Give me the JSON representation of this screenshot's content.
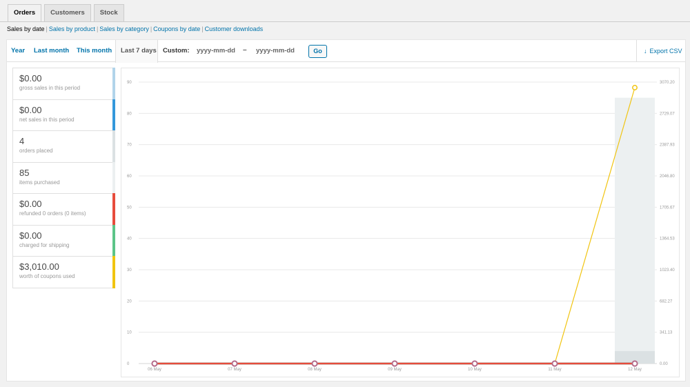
{
  "tabs": [
    {
      "label": "Orders",
      "active": true
    },
    {
      "label": "Customers",
      "active": false
    },
    {
      "label": "Stock",
      "active": false
    }
  ],
  "subnav": {
    "current": "Sales by date",
    "links": [
      "Sales by product",
      "Sales by category",
      "Coupons by date",
      "Customer downloads"
    ]
  },
  "range": {
    "year": "Year",
    "last_month": "Last month",
    "this_month": "This month",
    "last_7_days": "Last 7 days",
    "custom_label": "Custom:",
    "from_placeholder": "yyyy-mm-dd",
    "dash": "–",
    "to_placeholder": "yyyy-mm-dd",
    "go": "Go",
    "export": "Export CSV",
    "export_icon": "download-arrow-icon"
  },
  "legend": [
    {
      "value": "$0.00",
      "label": "gross sales in this period",
      "color": "#b1d4ea"
    },
    {
      "value": "$0.00",
      "label": "net sales in this period",
      "color": "#3498db"
    },
    {
      "value": "4",
      "label": "orders placed",
      "color": "#dbe1e3"
    },
    {
      "value": "85",
      "label": "items purchased",
      "color": "#ecf0f1"
    },
    {
      "value": "$0.00",
      "label": "refunded 0 orders (0 items)",
      "color": "#e74c3c"
    },
    {
      "value": "$0.00",
      "label": "charged for shipping",
      "color": "#5cc488"
    },
    {
      "value": "$3,010.00",
      "label": "worth of coupons used",
      "color": "#f1c40f"
    }
  ],
  "chart_data": {
    "type": "line",
    "categories": [
      "06 May",
      "07 May",
      "08 May",
      "09 May",
      "10 May",
      "11 May",
      "12 May"
    ],
    "y_left": {
      "ticks": [
        "0",
        "10",
        "20",
        "30",
        "40",
        "50",
        "60",
        "70",
        "80",
        "90"
      ],
      "range": [
        0,
        90
      ]
    },
    "y_right": {
      "ticks": [
        "0.00",
        "341.13",
        "682.27",
        "1023.40",
        "1364.53",
        "1705.67",
        "2046.80",
        "2387.93",
        "2729.07",
        "3070.20"
      ],
      "range": [
        0,
        3070.2
      ]
    },
    "grid": true,
    "series": [
      {
        "key": "items",
        "axis": "left",
        "kind": "bar",
        "color": "#ecf0f1",
        "values": [
          0,
          0,
          0,
          0,
          0,
          0,
          85
        ]
      },
      {
        "key": "orders",
        "axis": "left",
        "kind": "bar",
        "color": "#dbe1e3",
        "values": [
          0,
          0,
          0,
          0,
          0,
          0,
          4
        ]
      },
      {
        "key": "coupons",
        "axis": "right",
        "kind": "line",
        "color": "#f1c40f",
        "values": [
          0,
          0,
          0,
          0,
          0,
          0,
          3010
        ]
      },
      {
        "key": "gross",
        "axis": "right",
        "kind": "line",
        "color": "#b1d4ea",
        "values": [
          0,
          0,
          0,
          0,
          0,
          0,
          0
        ]
      },
      {
        "key": "net",
        "axis": "right",
        "kind": "line",
        "color": "#3498db",
        "values": [
          0,
          0,
          0,
          0,
          0,
          0,
          0
        ]
      },
      {
        "key": "shipping",
        "axis": "right",
        "kind": "line",
        "color": "#5cc488",
        "values": [
          0,
          0,
          0,
          0,
          0,
          0,
          0
        ]
      },
      {
        "key": "refunds",
        "axis": "right",
        "kind": "line",
        "color": "#e74c3c",
        "values": [
          0,
          0,
          0,
          0,
          0,
          0,
          0
        ]
      }
    ]
  }
}
